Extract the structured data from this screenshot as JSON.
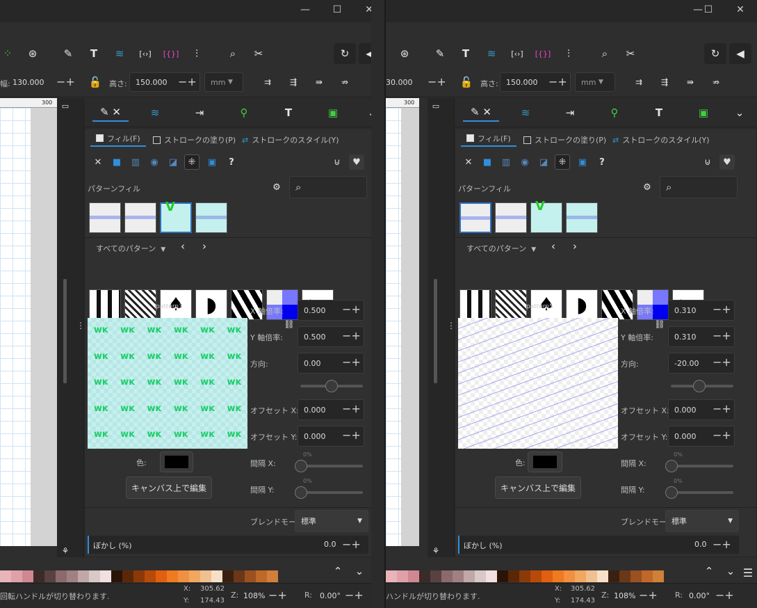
{
  "windows": [
    {
      "id": "left",
      "titlebar": {
        "minimize": "—",
        "maximize": "☐",
        "close": "✕"
      },
      "toolbar": {
        "w_label": "幅:",
        "w_value": "130.000",
        "h_label": "高さ:",
        "h_value": "150.000",
        "unit": "mm"
      },
      "ruler": {
        "tick": "300"
      },
      "dock_tabs": [
        "fill-stroke",
        "layers",
        "export",
        "xml",
        "text",
        "image"
      ],
      "fill": {
        "tab_fill": "フィル(F)",
        "tab_stroke_paint": "ストロークの塗り(P)",
        "tab_stroke_style": "ストロークのスタイル(Y)",
        "section": "パターンフィル",
        "collection": "すべてのパターン",
        "pattern_name": "pattern3",
        "x_scale_label": "X 軸倍率:",
        "x_scale": "0.500",
        "y_scale_label": "Y 軸倍率:",
        "y_scale": "0.500",
        "angle_label": "方向:",
        "angle": "0.00",
        "offset_x_label": "オフセット X:",
        "offset_x": "0.000",
        "offset_y_label": "オフセット Y:",
        "offset_y": "0.000",
        "gap_x_label": "間隔 X:",
        "gap_y_label": "間隔 Y:",
        "gap_pct": "0%",
        "color_label": "色:",
        "edit_button": "キャンバス上で編集",
        "blend_label": "ブレンドモード:",
        "blend_value": "標準",
        "blur_label": "ぼかし (%)",
        "blur_value": "0.0"
      },
      "status": {
        "message": "回転ハンドルが切り替わります.",
        "x_label": "X:",
        "x": "305.62",
        "y_label": "Y:",
        "y": "174.43",
        "z_label": "Z:",
        "zoom": "108%",
        "r_label": "R:",
        "rotation": "0.00°"
      }
    },
    {
      "id": "right",
      "titlebar": {
        "minimize": "—",
        "maximize": "☐",
        "close": "✕"
      },
      "toolbar": {
        "w_label": "",
        "w_value": "30.000",
        "h_label": "高さ:",
        "h_value": "150.000",
        "unit": "mm"
      },
      "ruler": {
        "tick": "300"
      },
      "dock_tabs": [
        "fill-stroke",
        "layers",
        "export",
        "xml",
        "text",
        "image"
      ],
      "fill": {
        "tab_fill": "フィル(F)",
        "tab_stroke_paint": "ストロークの塗り(P)",
        "tab_stroke_style": "ストロークのスタイル(Y)",
        "section": "パターンフィル",
        "collection": "すべてのパターン",
        "pattern_name": "pattern5",
        "x_scale_label": "X 軸倍率:",
        "x_scale": "0.310",
        "y_scale_label": "Y 軸倍率:",
        "y_scale": "0.310",
        "angle_label": "方向:",
        "angle": "-20.00",
        "offset_x_label": "オフセット X:",
        "offset_x": "0.000",
        "offset_y_label": "オフセット Y:",
        "offset_y": "0.000",
        "gap_x_label": "間隔 X:",
        "gap_y_label": "間隔 Y:",
        "gap_pct": "0%",
        "color_label": "色:",
        "edit_button": "キャンバス上で編集",
        "blend_label": "ブレンドモード:",
        "blend_value": "標準",
        "blur_label": "ぼかし (%)",
        "blur_value": "0.0"
      },
      "status": {
        "message": "ハンドルが切り替わります.",
        "x_label": "X:",
        "x": "305.62",
        "y_label": "Y:",
        "y": "174.43",
        "z_label": "Z:",
        "zoom": "108%",
        "r_label": "R:",
        "rotation": "0.00°"
      }
    }
  ],
  "palette": [
    "#e8b4b8",
    "#e0a0a8",
    "#d08890",
    "#3a2a2a",
    "#5a4040",
    "#8a6a6a",
    "#a08080",
    "#c0a8a8",
    "#d8c8c8",
    "#f0e0e0",
    "#2a1408",
    "#5a2808",
    "#8a3a08",
    "#b84a08",
    "#e06010",
    "#f07a20",
    "#f09040",
    "#f0a860",
    "#f0c090",
    "#f8e0c8",
    "#3a2010",
    "#6a3818",
    "#9a5020",
    "#c06828",
    "#d08038"
  ],
  "accent": "#2f8fdb"
}
